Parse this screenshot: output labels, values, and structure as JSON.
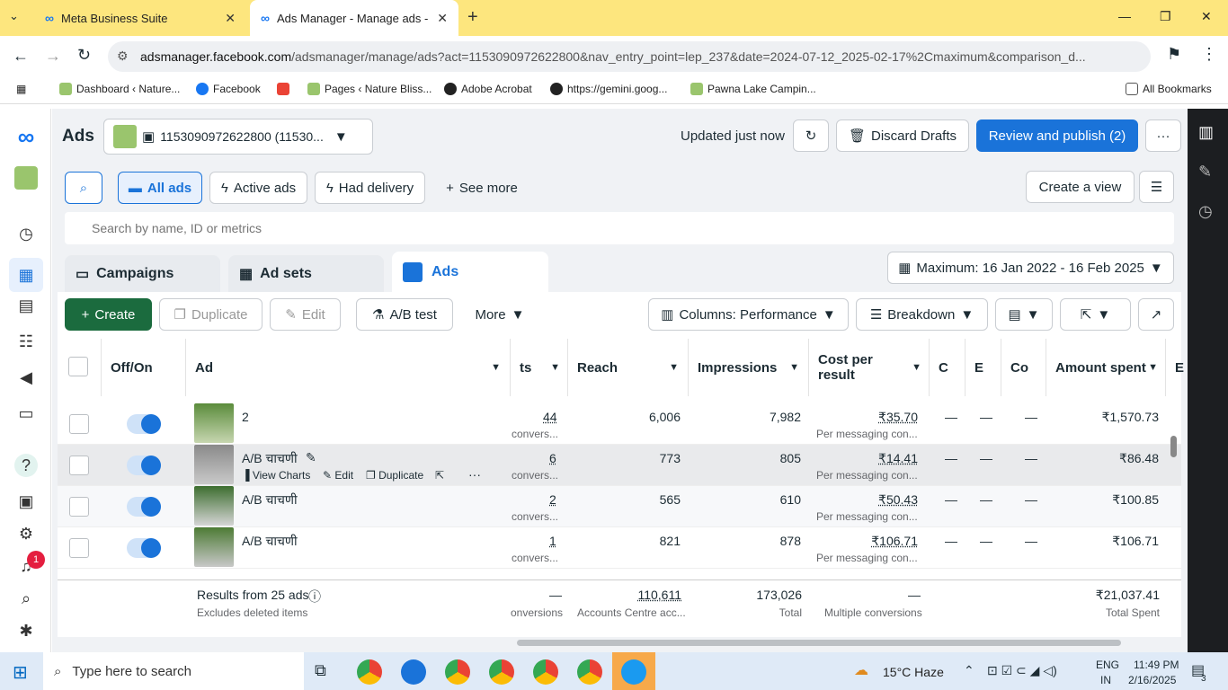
{
  "browser": {
    "tabs": [
      {
        "label": "Meta Business Suite"
      },
      {
        "label": "Ads Manager - Manage ads - A"
      }
    ],
    "url_host": "adsmanager.facebook.com",
    "url_path": "/adsmanager/manage/ads?act=1153090972622800&nav_entry_point=lep_237&date=2024-07-12_2025-02-17%2Cmaximum&comparison_d...",
    "bookmarks": [
      "Dashboard ‹ Nature...",
      "Facebook",
      "Pages ‹ Nature Bliss...",
      "Adobe Acrobat",
      "https://gemini.goog...",
      "Pawna Lake Campin..."
    ],
    "all_bookmarks": "All Bookmarks"
  },
  "header": {
    "title": "Ads",
    "account": "1153090972622800 (11530...",
    "updated": "Updated just now",
    "discard": "Discard Drafts",
    "publish": "Review and publish (2)",
    "more": "···"
  },
  "filters": {
    "all_ads": "All ads",
    "active_ads": "Active ads",
    "had_delivery": "Had delivery",
    "see_more": "See more",
    "create_view": "Create a view"
  },
  "search": {
    "placeholder": "Search by name, ID or metrics"
  },
  "levels": {
    "campaigns": "Campaigns",
    "adsets": "Ad sets",
    "ads": "Ads"
  },
  "date_range": "Maximum: 16 Jan 2022 - 16 Feb 2025",
  "toolbar": {
    "create": "Create",
    "duplicate": "Duplicate",
    "edit": "Edit",
    "ab_test": "A/B test",
    "more": "More",
    "columns": "Columns: Performance",
    "breakdown": "Breakdown"
  },
  "table": {
    "headers": {
      "offon": "Off/On",
      "ad": "Ad",
      "results": "ts",
      "reach": "Reach",
      "impressions": "Impressions",
      "cpr": "Cost per result",
      "c1": "C",
      "c2": "E",
      "c3": "Co",
      "amount": "Amount spent",
      "e": "E"
    },
    "rows": [
      {
        "name": "2",
        "results": "44",
        "results_sub": "convers...",
        "reach": "6,006",
        "impressions": "7,982",
        "cpr": "₹35.70",
        "cpr_sub": "Per messaging con...",
        "c1": "—",
        "c2": "—",
        "c3": "—",
        "amount": "₹1,570.73"
      },
      {
        "name": "A/B चाचणी",
        "results": "6",
        "results_sub": "convers...",
        "reach": "773",
        "impressions": "805",
        "cpr": "₹14.41",
        "cpr_sub": "Per messaging con...",
        "c1": "—",
        "c2": "—",
        "c3": "—",
        "amount": "₹86.48"
      },
      {
        "name": "A/B चाचणी",
        "results": "2",
        "results_sub": "convers...",
        "reach": "565",
        "impressions": "610",
        "cpr": "₹50.43",
        "cpr_sub": "Per messaging con...",
        "c1": "—",
        "c2": "—",
        "c3": "—",
        "amount": "₹100.85"
      },
      {
        "name": "A/B चाचणी",
        "results": "1",
        "results_sub": "convers...",
        "reach": "821",
        "impressions": "878",
        "cpr": "₹106.71",
        "cpr_sub": "Per messaging con...",
        "c1": "—",
        "c2": "—",
        "c3": "—",
        "amount": "₹106.71"
      }
    ],
    "row_actions": {
      "view_charts": "View Charts",
      "edit": "Edit",
      "duplicate": "Duplicate"
    },
    "footer": {
      "results": "Results from 25 ads",
      "excludes": "Excludes deleted items",
      "conv": "onversions",
      "reach": "110,611",
      "reach_sub": "Accounts Centre acc...",
      "impressions": "173,026",
      "impressions_sub": "Total",
      "cpr": "—",
      "cpr_sub": "Multiple conversions",
      "amount": "₹21,037.41",
      "amount_sub": "Total Spent"
    }
  },
  "nav": {
    "notification_count": "1"
  },
  "taskbar": {
    "search": "Type here to search",
    "weather": "15°C  Haze",
    "lang1": "ENG",
    "lang2": "IN",
    "time": "11:49 PM",
    "date": "2/16/2025",
    "notif": "3"
  }
}
